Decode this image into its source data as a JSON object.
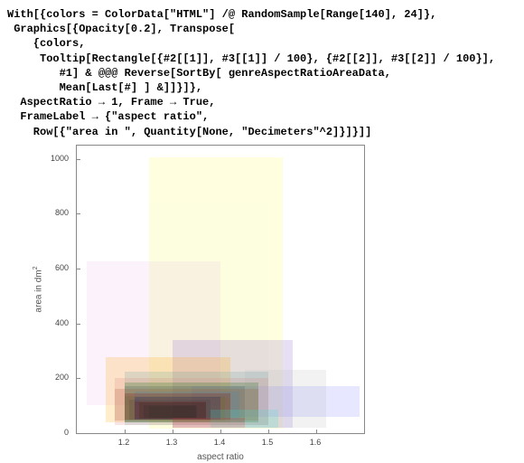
{
  "code": {
    "l1": "With[{colors = ColorData[\"HTML\"] /@ RandomSample[Range[140], 24]},",
    "l2": " Graphics[{Opacity[0.2], Transpose[",
    "l3": "    {colors,",
    "l4": "     Tooltip[Rectangle[{#2[[1]], #3[[1]] / 100}, {#2[[2]], #3[[2]] / 100}],",
    "l5": "        #1] & @@@ Reverse[SortBy[ genreAspectRatioAreaData,",
    "l6": "        Mean[Last[#] ] &]]}]},",
    "l7": "  AspectRatio → 1, Frame → True,",
    "l8": "  FrameLabel → {\"aspect ratio\",",
    "l9": "    Row[{\"area in \", Quantity[None, \"Decimeters\"^2]}]}]]"
  },
  "chart_data": {
    "type": "area",
    "title": "",
    "xlabel": "aspect ratio",
    "ylabel_prefix": "area in dm",
    "ylabel_exp": "2",
    "xlim": [
      1.1,
      1.7
    ],
    "ylim": [
      0,
      1050
    ],
    "x_ticks": [
      1.2,
      1.3,
      1.4,
      1.5,
      1.6
    ],
    "y_ticks": [
      0,
      200,
      400,
      600,
      800,
      1000
    ],
    "rects": [
      {
        "x1": 1.25,
        "x2": 1.53,
        "y1": 15,
        "y2": 1005,
        "color": "#FFFF66"
      },
      {
        "x1": 1.12,
        "x2": 1.4,
        "y1": 100,
        "y2": 625,
        "color": "#EEC0EE"
      },
      {
        "x1": 1.25,
        "x2": 1.5,
        "y1": 25,
        "y2": 840,
        "color": "#F5F5DC"
      },
      {
        "x1": 1.3,
        "x2": 1.55,
        "y1": 20,
        "y2": 340,
        "color": "#8866CC"
      },
      {
        "x1": 1.16,
        "x2": 1.42,
        "y1": 40,
        "y2": 275,
        "color": "#FFA500"
      },
      {
        "x1": 1.34,
        "x2": 1.69,
        "y1": 60,
        "y2": 170,
        "color": "#8888FF"
      },
      {
        "x1": 1.45,
        "x2": 1.62,
        "y1": 20,
        "y2": 230,
        "color": "#C0C0C0"
      },
      {
        "x1": 1.2,
        "x2": 1.5,
        "y1": 30,
        "y2": 225,
        "color": "#5F9EA0"
      },
      {
        "x1": 1.18,
        "x2": 1.5,
        "y1": 30,
        "y2": 200,
        "color": "#DD8080"
      },
      {
        "x1": 1.2,
        "x2": 1.48,
        "y1": 40,
        "y2": 185,
        "color": "#006400"
      },
      {
        "x1": 1.2,
        "x2": 1.45,
        "y1": 40,
        "y2": 170,
        "color": "#2F4F4F"
      },
      {
        "x1": 1.18,
        "x2": 1.48,
        "y1": 45,
        "y2": 160,
        "color": "#A0522D"
      },
      {
        "x1": 1.22,
        "x2": 1.44,
        "y1": 50,
        "y2": 150,
        "color": "#4682B4"
      },
      {
        "x1": 1.2,
        "x2": 1.42,
        "y1": 50,
        "y2": 145,
        "color": "#8B0000"
      },
      {
        "x1": 1.2,
        "x2": 1.41,
        "y1": 45,
        "y2": 135,
        "color": "#556B2F"
      },
      {
        "x1": 1.22,
        "x2": 1.4,
        "y1": 48,
        "y2": 130,
        "color": "#000080"
      },
      {
        "x1": 1.23,
        "x2": 1.42,
        "y1": 50,
        "y2": 128,
        "color": "#896434"
      },
      {
        "x1": 1.21,
        "x2": 1.38,
        "y1": 50,
        "y2": 120,
        "color": "#404040"
      },
      {
        "x1": 1.22,
        "x2": 1.37,
        "y1": 52,
        "y2": 115,
        "color": "#800000"
      },
      {
        "x1": 1.23,
        "x2": 1.37,
        "y1": 52,
        "y2": 110,
        "color": "#202020"
      },
      {
        "x1": 1.38,
        "x2": 1.52,
        "y1": 20,
        "y2": 85,
        "color": "#40E0D0"
      },
      {
        "x1": 1.3,
        "x2": 1.45,
        "y1": 18,
        "y2": 55,
        "color": "#DD3030"
      },
      {
        "x1": 1.24,
        "x2": 1.35,
        "y1": 55,
        "y2": 102,
        "color": "#222222"
      },
      {
        "x1": 1.25,
        "x2": 1.35,
        "y1": 56,
        "y2": 98,
        "color": "#2E2E2E"
      }
    ]
  }
}
